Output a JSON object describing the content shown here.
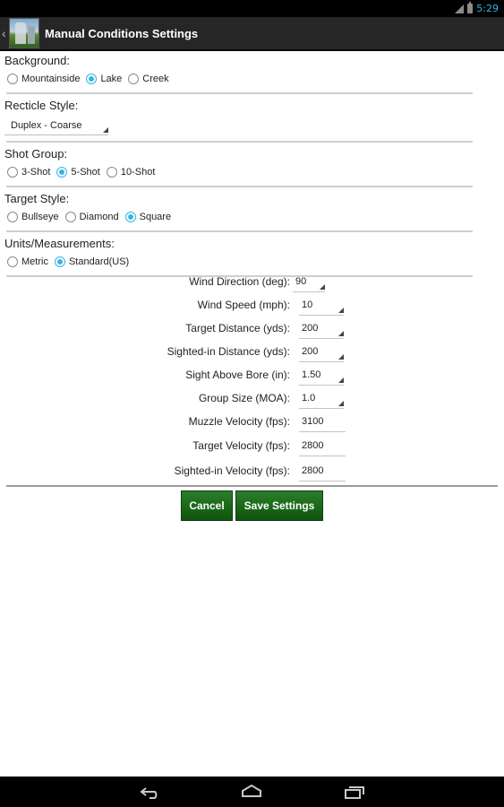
{
  "status_bar": {
    "time": "5:29",
    "colors": {
      "accent": "#33b5e5"
    },
    "icons": [
      "signal-icon",
      "battery-icon"
    ]
  },
  "action_bar": {
    "title": "Manual Conditions Settings",
    "icons": [
      "back-icon",
      "app-icon"
    ]
  },
  "background": {
    "label": "Background:",
    "options": [
      {
        "label": "Mountainside",
        "checked": false
      },
      {
        "label": "Lake",
        "checked": true
      },
      {
        "label": "Creek",
        "checked": false
      }
    ]
  },
  "reticle": {
    "label": "Recticle Style:",
    "value": "Duplex - Coarse"
  },
  "shot_group": {
    "label": "Shot Group:",
    "options": [
      {
        "label": "3-Shot",
        "checked": false
      },
      {
        "label": "5-Shot",
        "checked": true
      },
      {
        "label": "10-Shot",
        "checked": false
      }
    ]
  },
  "target_style": {
    "label": "Target Style:",
    "options": [
      {
        "label": "Bullseye",
        "checked": false
      },
      {
        "label": "Diamond",
        "checked": false
      },
      {
        "label": "Square",
        "checked": true
      }
    ]
  },
  "units": {
    "label": "Units/Measurements:",
    "options": [
      {
        "label": "Metric",
        "checked": false
      },
      {
        "label": "Standard(US)",
        "checked": true
      }
    ]
  },
  "form": {
    "wind_direction": {
      "label": "Wind Direction (deg):",
      "value": "90"
    },
    "wind_speed": {
      "label": "Wind Speed (mph):",
      "value": "10"
    },
    "target_distance": {
      "label": "Target Distance (yds):",
      "value": "200"
    },
    "sighted_distance": {
      "label": "Sighted-in Distance (yds):",
      "value": "200"
    },
    "sight_above_bore": {
      "label": "Sight Above Bore (in):",
      "value": "1.50"
    },
    "group_size": {
      "label": "Group Size (MOA):",
      "value": "1.0"
    },
    "muzzle_velocity": {
      "label": "Muzzle Velocity (fps):",
      "value": "3100"
    },
    "target_velocity": {
      "label": "Target Velocity (fps):",
      "value": "2800"
    },
    "sighted_velocity": {
      "label": "Sighted-in Velocity (fps):",
      "value": "2800"
    }
  },
  "buttons": {
    "cancel": "Cancel",
    "save": "Save Settings",
    "color": "#1b6a1b"
  },
  "nav_bar": {
    "icons": [
      "nav-back-icon",
      "home-icon",
      "recent-apps-icon"
    ]
  }
}
